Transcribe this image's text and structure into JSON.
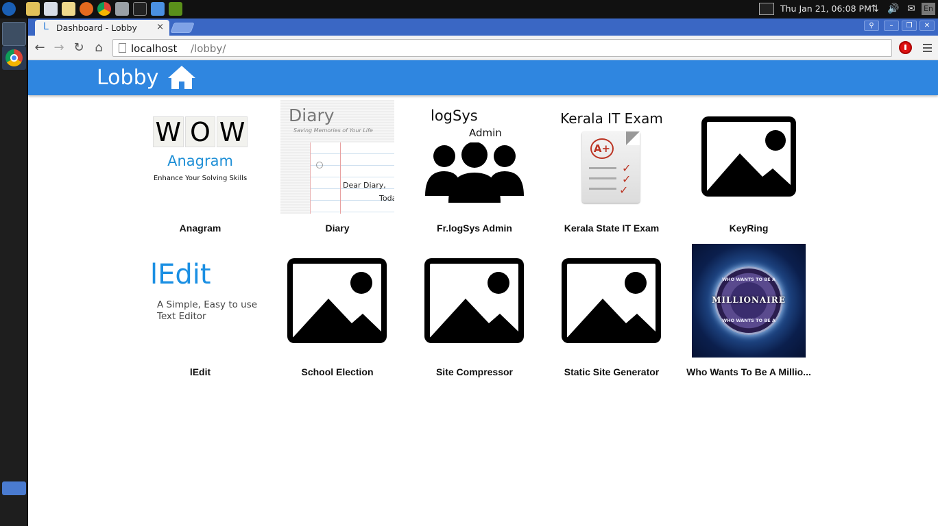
{
  "system_panel": {
    "clock": "Thu Jan 21, 06:08 PM",
    "keyboard_layout": "En"
  },
  "browser": {
    "tab": {
      "favicon": "L",
      "title": "Dashboard - Lobby",
      "close": "×"
    },
    "omnibox": {
      "host": "localhost",
      "path": "/lobby/"
    }
  },
  "page": {
    "header": {
      "title": "Lobby"
    },
    "apps": [
      {
        "label": "Anagram",
        "icon": "anagram-thumbnail",
        "thumb_text": {
          "wow": [
            "W",
            "O",
            "W"
          ],
          "name": "Anagram",
          "tagline": "Enhance Your Solving Skills"
        }
      },
      {
        "label": "Diary",
        "icon": "diary-thumbnail",
        "thumb_text": {
          "title": "Diary",
          "subtitle": "Saving Memories of Your Life",
          "note": "Dear Diary,",
          "note2": "Toda"
        }
      },
      {
        "label": "Fr.logSys Admin",
        "icon": "logsys-admin-thumbnail",
        "thumb_text": {
          "title": "logSys",
          "subtitle": "Admin"
        }
      },
      {
        "label": "Kerala State IT Exam",
        "icon": "it-exam-thumbnail",
        "thumb_text": {
          "title": "Kerala IT Exam",
          "grade": "A+"
        }
      },
      {
        "label": "KeyRing",
        "icon": "image-placeholder-icon"
      },
      {
        "label": "lEdit",
        "icon": "ledit-thumbnail",
        "thumb_text": {
          "title": "lEdit",
          "line1": "A Simple, Easy to use",
          "line2": "Text Editor"
        }
      },
      {
        "label": "School Election",
        "icon": "image-placeholder-icon"
      },
      {
        "label": "Site Compressor",
        "icon": "image-placeholder-icon"
      },
      {
        "label": "Static Site Generator",
        "icon": "image-placeholder-icon"
      },
      {
        "label": "Who Wants To Be A Millio...",
        "icon": "millionaire-thumbnail",
        "thumb_text": {
          "title": "MILLIONAIRE",
          "ring_top": "WHO WANTS TO BE A",
          "ring_bottom": "WHO WANTS TO BE A"
        }
      }
    ]
  },
  "colors": {
    "header_bg": "#2f86e0",
    "tabstrip_bg": "#3a67c4",
    "ledit_blue": "#1a8fe3",
    "anagram_blue": "#1e8fd6"
  }
}
